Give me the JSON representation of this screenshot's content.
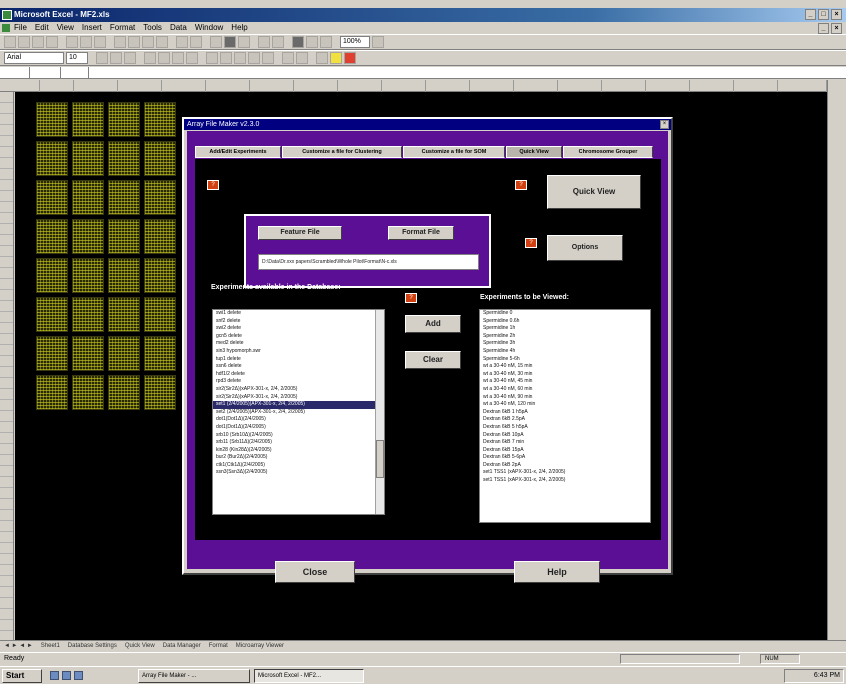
{
  "window": {
    "title": "Microsoft Excel - MF2.xls",
    "minimize_glyph": "_",
    "maximize_glyph": "□",
    "close_glyph": "×"
  },
  "menubar": {
    "items": [
      "File",
      "Edit",
      "View",
      "Insert",
      "Format",
      "Tools",
      "Data",
      "Window",
      "Help"
    ]
  },
  "toolbar": {
    "zoom": "100%",
    "font_name": "Arial",
    "font_size": "10"
  },
  "dialog": {
    "title": "Array File Maker v2.3.0",
    "close_glyph": "×",
    "tabs": [
      "Add/Edit Experiments",
      "Customize a file for Clustering",
      "Customize a file for SOM",
      "Quick View",
      "Chromosome Grouper"
    ],
    "active_tab": "Quick View",
    "tip_glyph": "?",
    "buttons": {
      "feature_file": "Feature File",
      "format_file": "Format File",
      "quick_view": "Quick View",
      "options": "Options",
      "add": "Add",
      "clear": "Clear",
      "close": "Close",
      "help": "Help"
    },
    "file_path": "D:\\Data\\Dr.xxx papers\\Scrambled\\Whole Pilot\\Format\\N-c.xls",
    "labels": {
      "available": "Experiments available in the Database:",
      "to_view": "Experiments to be Viewed:"
    },
    "available_list": {
      "items": [
        "swi1 delete",
        "snf2 delete",
        "swi2 delete",
        "gcn5 delete",
        "med2 delete",
        "sin3 hypomorph.swr",
        "tup1 delete",
        "ssn6 delete",
        "hdf1/2 delete",
        "rpd3 delete",
        "sir2(Sir2Δ)(xAPX-301-x, 2/4, 2/2005)",
        "sir2(Sir2Δ)(xAPX-301-x, 2/4, 2/2005)",
        "set1 (2/4/2005)(APX-301-x, 2/4, 2/2005)",
        "set2 (2/4/2005)(APX-301-x, 2/4, 2/2005)",
        "dot1(Dot1Δ)(2/4/2005)",
        "dot1(Dot1Δ)(2/4/2005)",
        "srb10 (Srb10Δ)(2/4/2005)",
        "srb11 (Srb11Δ)(2/4/2005)",
        "kin28 (Kin28Δ)(2/4/2005)",
        "bur2 (Bur2Δ)(2/4/2005)",
        "ctk1(Ctk1Δ)(2/4/2005)",
        "ssn3(Ssn3Δ)(2/4/2005)"
      ],
      "selected_index": 12
    },
    "view_list": {
      "items": [
        "Spermidine 0",
        "Spermidine 0.6h",
        "Spermidine 1h",
        "Spermidine 2h",
        "Spermidine 3h",
        "Spermidine 4h",
        "Spermidine 5-6h",
        "wt a 30-40 nM, 15 min",
        "wt a 30-40 nM, 30 min",
        "wt a 30-40 nM, 45 min",
        "wt a 30-40 nM, 60 min",
        "wt a 30-40 nM, 90 min",
        "wt a 30-40 nM, 120 min",
        "Dextran 6kB 1 h5pA",
        "Dextran 6kB 2.5pA",
        "Dextran 6kB 5 h5pA",
        "Dextran 6kB 10pA",
        "Dextran 6kB 7 min",
        "Dextran 6kB 15pA",
        "Dextran 6kB 5-6pA",
        "Dextran 6kB 2pA",
        "set1 TSS1 (xAPX-301-x, 2/4, 2/2005)",
        "set1 TSS1 (xAPX-301-x, 2/4, 2/2005)"
      ]
    }
  },
  "sheet_tabs": [
    "Sheet1",
    "Database Settings",
    "Quick View",
    "Data Manager",
    "Format",
    "Microarray Viewer"
  ],
  "statusbar": {
    "text": "Ready",
    "mode": "NUM"
  },
  "taskbar": {
    "start": "Start",
    "tasks": [
      "Array File Maker - ...",
      "Microsoft Excel - MF2..."
    ],
    "clock": "6:43 PM"
  }
}
